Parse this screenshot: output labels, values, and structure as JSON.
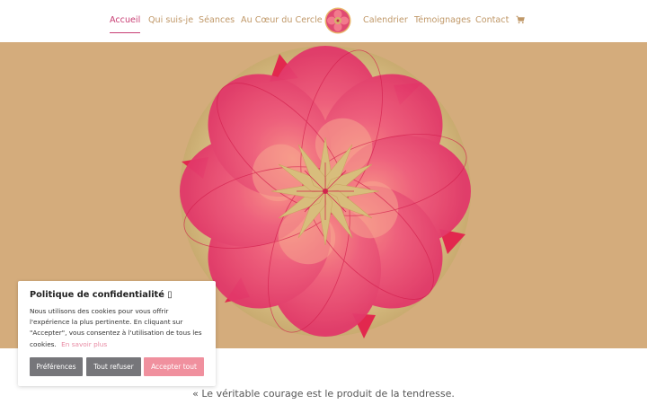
{
  "nav": {
    "items": [
      {
        "label": "Accueil",
        "active": true
      },
      {
        "label": "Qui suis-je"
      },
      {
        "label": "Séances"
      },
      {
        "label": "Au Cœur du Cercle"
      },
      {
        "label": "Calendrier"
      },
      {
        "label": "Témoignages"
      },
      {
        "label": "Contact"
      }
    ],
    "cart_icon": "cart-icon",
    "logo_icon": "mandala-logo"
  },
  "hero": {
    "image": "mandala-flower-watercolor",
    "background_color": "#d4ac7c"
  },
  "quote": {
    "text": "« Le véritable courage est le produit de la tendresse."
  },
  "cookie": {
    "title": "Politique de confidentialité ▯",
    "body": "Nous utilisons des cookies pour vous offrir l'expérience la plus pertinente. En cliquant sur \"Accepter\", vous consentez à l'utilisation de tous les cookies.",
    "link": "En savoir plus",
    "buttons": {
      "preferences": "Préférences",
      "refuse": "Tout refuser",
      "accept": "Accepter tout"
    }
  },
  "colors": {
    "accent": "#c83d73",
    "nav_text": "#c09868",
    "accept_button": "#f0909e",
    "secondary_button": "#76767a"
  }
}
